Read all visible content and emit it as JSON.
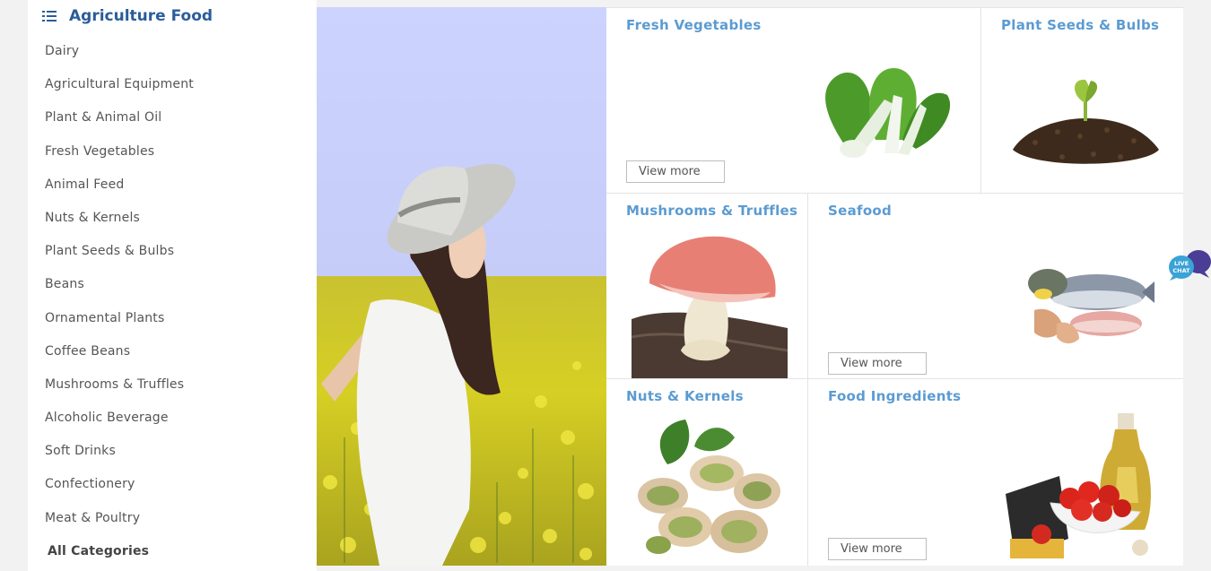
{
  "sidebar": {
    "title": "Agriculture Food",
    "title_icon": "list-icon",
    "categories": [
      "Dairy",
      "Agricultural Equipment",
      "Plant & Animal Oil",
      "Fresh Vegetables",
      "Animal Feed",
      "Nuts & Kernels",
      "Plant Seeds & Bulbs",
      "Beans",
      "Ornamental Plants",
      "Coffee Beans",
      "Mushrooms & Truffles",
      "Alcoholic Beverage",
      "Soft Drinks",
      "Confectionery",
      "Meat & Poultry"
    ],
    "all_categories": "All Categories"
  },
  "tiles": {
    "fresh_vegetables": {
      "title": "Fresh Vegetables",
      "button": "View more",
      "icon": "bok-choy-image"
    },
    "plant_seeds": {
      "title": "Plant Seeds & Bulbs",
      "icon": "seedling-soil-image"
    },
    "mushrooms": {
      "title": "Mushrooms & Truffles",
      "icon": "mushroom-image"
    },
    "seafood": {
      "title": "Seafood",
      "button": "View more",
      "icon": "seafood-platter-image"
    },
    "nuts": {
      "title": "Nuts & Kernels",
      "icon": "pistachio-image"
    },
    "food_ingredients": {
      "title": "Food Ingredients",
      "button": "View more",
      "icon": "olive-oil-tomatoes-image"
    }
  },
  "live_chat": {
    "label_line1": "LIVE",
    "label_line2": "CHAT"
  },
  "colors": {
    "accent": "#2a5d9a",
    "tile_title": "#5b9bd1",
    "hero_sky": "#cdd3ff",
    "field_yellow": "#d8d02a"
  }
}
